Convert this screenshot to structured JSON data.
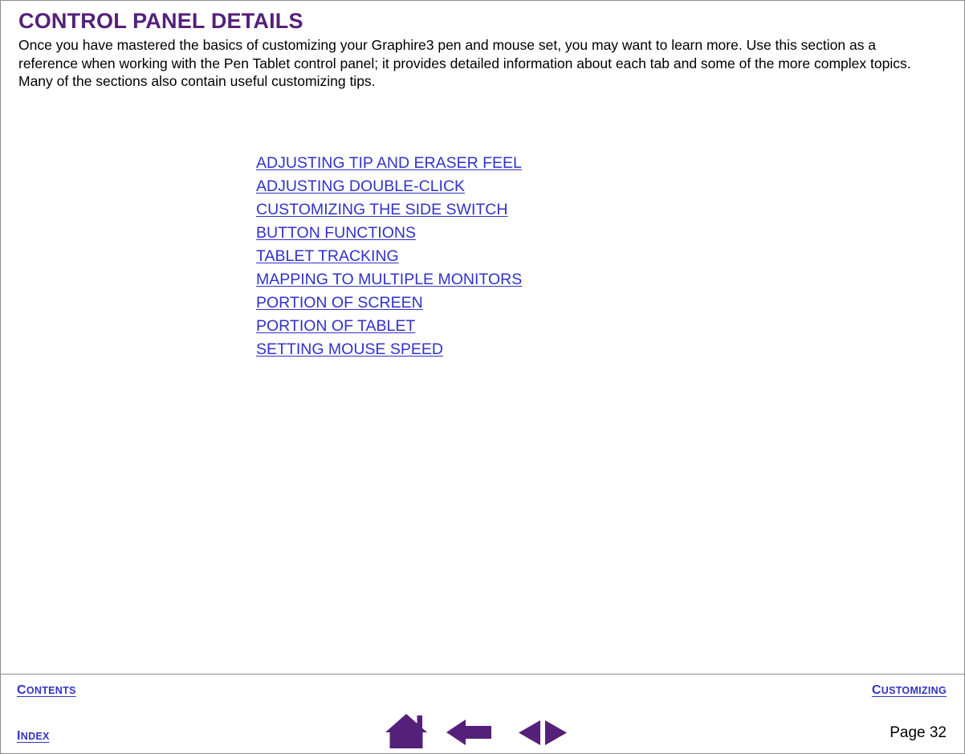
{
  "document": {
    "title": "CONTROL PANEL DETAILS",
    "intro": "Once you have mastered the basics of customizing your Graphire3 pen and mouse set, you may want to learn more.  Use this section as a reference when working with the Pen Tablet control panel; it provides detailed information about each tab and some of the more complex topics.  Many of the sections also contain useful customizing tips."
  },
  "colors": {
    "heading_purple": "#55207A",
    "link_blue": "#3232C8",
    "icon_purple": "#55207A",
    "rule_gray": "#8C8C8C",
    "body_text": "#000000"
  },
  "toc": {
    "links": [
      {
        "label": "ADJUSTING TIP AND ERASER FEEL"
      },
      {
        "label": "ADJUSTING DOUBLE-CLICK"
      },
      {
        "label": "CUSTOMIZING THE SIDE SWITCH"
      },
      {
        "label": "BUTTON FUNCTIONS"
      },
      {
        "label": "TABLET TRACKING"
      },
      {
        "label": "MAPPING TO MULTIPLE MONITORS"
      },
      {
        "label": "PORTION OF SCREEN"
      },
      {
        "label": "PORTION OF TABLET"
      },
      {
        "label": "SETTING MOUSE SPEED"
      }
    ]
  },
  "footer": {
    "contents": {
      "first": "C",
      "rest": "ONTENTS"
    },
    "index": {
      "first": "I",
      "rest": "NDEX"
    },
    "customizing": {
      "first": "C",
      "rest": "USTOMIZING"
    },
    "page_label": "Page  32",
    "icons": [
      {
        "name": "home-icon",
        "label": "Home"
      },
      {
        "name": "back-arrow-icon",
        "label": "Back"
      },
      {
        "name": "previous-next-page-icon",
        "label": "Previous / Next page"
      }
    ]
  }
}
